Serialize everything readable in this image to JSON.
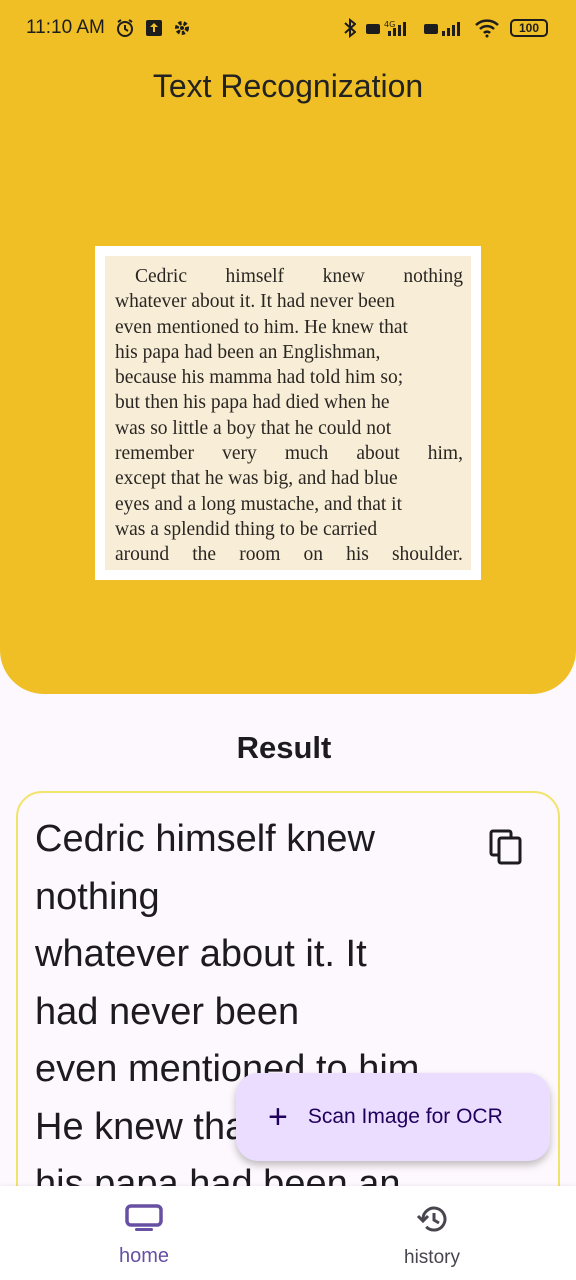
{
  "status_bar": {
    "time": "11:10 AM",
    "battery": "100",
    "network": "4G"
  },
  "header": {
    "title": "Text Recognization"
  },
  "preview": {
    "lines": [
      [
        "Cedric",
        "himself",
        "knew",
        "nothing"
      ],
      [
        "whatever about it. It had never been"
      ],
      [
        "even mentioned to him. He knew that"
      ],
      [
        "his papa had been an Englishman,"
      ],
      [
        "because his mamma had told him so;"
      ],
      [
        "but then his papa had died when he"
      ],
      [
        "was so little a boy that he could not"
      ],
      [
        "remember",
        "very",
        "much",
        "about",
        "him,"
      ],
      [
        "except that he was big, and had blue"
      ],
      [
        "eyes and a long mustache, and that it"
      ],
      [
        "was a splendid thing to be carried"
      ],
      [
        "around",
        "the",
        "room",
        "on",
        "his",
        "shoulder."
      ]
    ]
  },
  "result": {
    "title": "Result",
    "lines": [
      "Cedric himself knew",
      "nothing",
      "whatever about it. It",
      "had never been",
      "even mentioned to him.",
      "He knew that",
      "his papa had been an"
    ]
  },
  "fab": {
    "label": "Scan Image for OCR"
  },
  "nav": {
    "items": [
      {
        "label": "home",
        "icon": "tv-icon",
        "active": true
      },
      {
        "label": "history",
        "icon": "history-icon",
        "active": false
      }
    ]
  },
  "colors": {
    "accent_yellow": "#f0bf25",
    "primary": "#6750a4",
    "fab_bg": "#eaddff",
    "card_border": "#f2e36a"
  }
}
